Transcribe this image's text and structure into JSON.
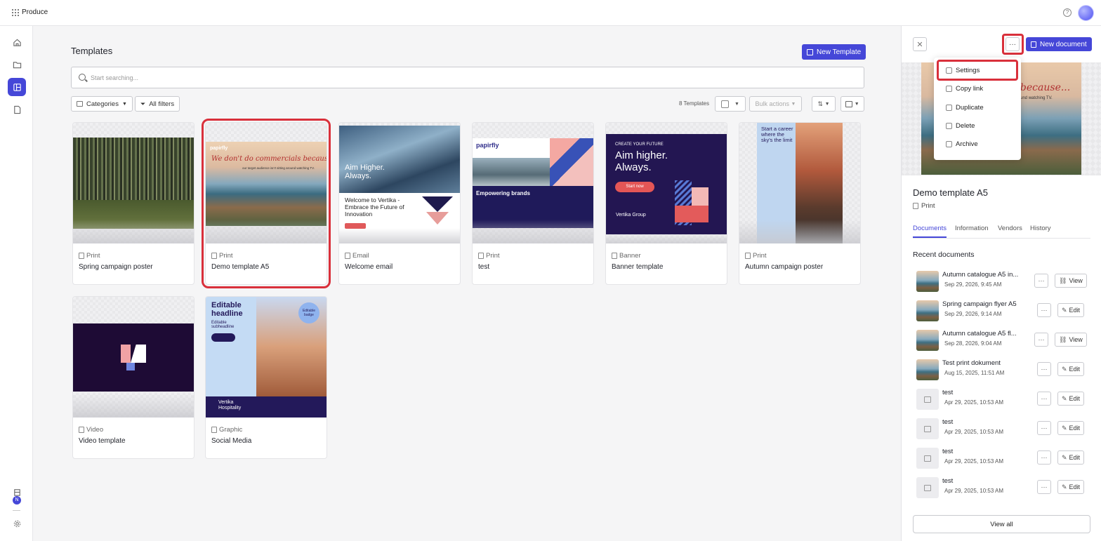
{
  "header": {
    "app_name": "Produce",
    "help_icon": "help-circle-icon"
  },
  "main": {
    "title": "Templates",
    "new_template_label": "New Template",
    "search_placeholder": "Start searching...",
    "categories_label": "Categories",
    "all_filters_label": "All filters",
    "count_label": "8 Templates",
    "bulk_actions_label": "Bulk actions"
  },
  "templates": [
    {
      "type": "Print",
      "name": "Spring campaign poster"
    },
    {
      "type": "Print",
      "name": "Demo template A5"
    },
    {
      "type": "Email",
      "name": "Welcome email"
    },
    {
      "type": "Print",
      "name": "test"
    },
    {
      "type": "Banner",
      "name": "Banner template"
    },
    {
      "type": "Print",
      "name": "Autumn campaign poster"
    },
    {
      "type": "Video",
      "name": "Video template"
    },
    {
      "type": "Graphic",
      "name": "Social Media"
    }
  ],
  "thumbs": {
    "demo_headline": "We don't do commercials because...",
    "demo_sub": "our target audience isn't sitting around watching TV.",
    "email_head": "Aim Higher. Always.",
    "email_body": "Welcome to Vertika - Embrace the Future of Innovation",
    "test_brand": "papirfly",
    "test_body": "Empowering brands",
    "banner_top": "CREATE YOUR FUTURE",
    "banner_head": "Aim higher. Always.",
    "banner_btn": "Start now",
    "banner_brand": "Vertika Group",
    "autumn_head": "Start a career where the sky's the limit",
    "social_head": "Editable headline",
    "social_sub": "Editable subheadline",
    "social_badge": "Editable badge",
    "social_brand": "Vertika Hospitality"
  },
  "panel": {
    "new_document_label": "New document",
    "menu": [
      {
        "label": "Settings",
        "icon": "gear-icon"
      },
      {
        "label": "Copy link",
        "icon": "link-icon"
      },
      {
        "label": "Duplicate",
        "icon": "duplicate-icon"
      },
      {
        "label": "Delete",
        "icon": "trash-icon"
      },
      {
        "label": "Archive",
        "icon": "archive-icon"
      }
    ],
    "preview_headline": "ials because...",
    "preview_sub": "sitting around watching TV.",
    "title": "Demo template A5",
    "type": "Print",
    "tabs": [
      "Documents",
      "Information",
      "Vendors",
      "History"
    ],
    "recent_title": "Recent documents",
    "documents": [
      {
        "name": "Autumn catalogue A5 in...",
        "date": "Sep 29, 2026, 9:45 AM",
        "action": "View",
        "thumb": true
      },
      {
        "name": "Spring campaign flyer A5",
        "date": "Sep 29, 2026, 9:14 AM",
        "action": "Edit",
        "thumb": true
      },
      {
        "name": "Autumn catalogue A5 fl...",
        "date": "Sep 28, 2026, 9:04 AM",
        "action": "View",
        "thumb": true
      },
      {
        "name": "Test print dokument",
        "date": "Aug 15, 2025, 11:51 AM",
        "action": "Edit",
        "thumb": true
      },
      {
        "name": "test",
        "date": "Apr 29, 2025, 10:53 AM",
        "action": "Edit",
        "thumb": false
      },
      {
        "name": "test",
        "date": "Apr 29, 2025, 10:53 AM",
        "action": "Edit",
        "thumb": false
      },
      {
        "name": "test",
        "date": "Apr 29, 2025, 10:53 AM",
        "action": "Edit",
        "thumb": false
      },
      {
        "name": "test",
        "date": "Apr 29, 2025, 10:53 AM",
        "action": "Edit",
        "thumb": false
      }
    ],
    "view_all_label": "View all"
  },
  "colors": {
    "accent": "#4547d8",
    "highlight": "#d9303b"
  }
}
